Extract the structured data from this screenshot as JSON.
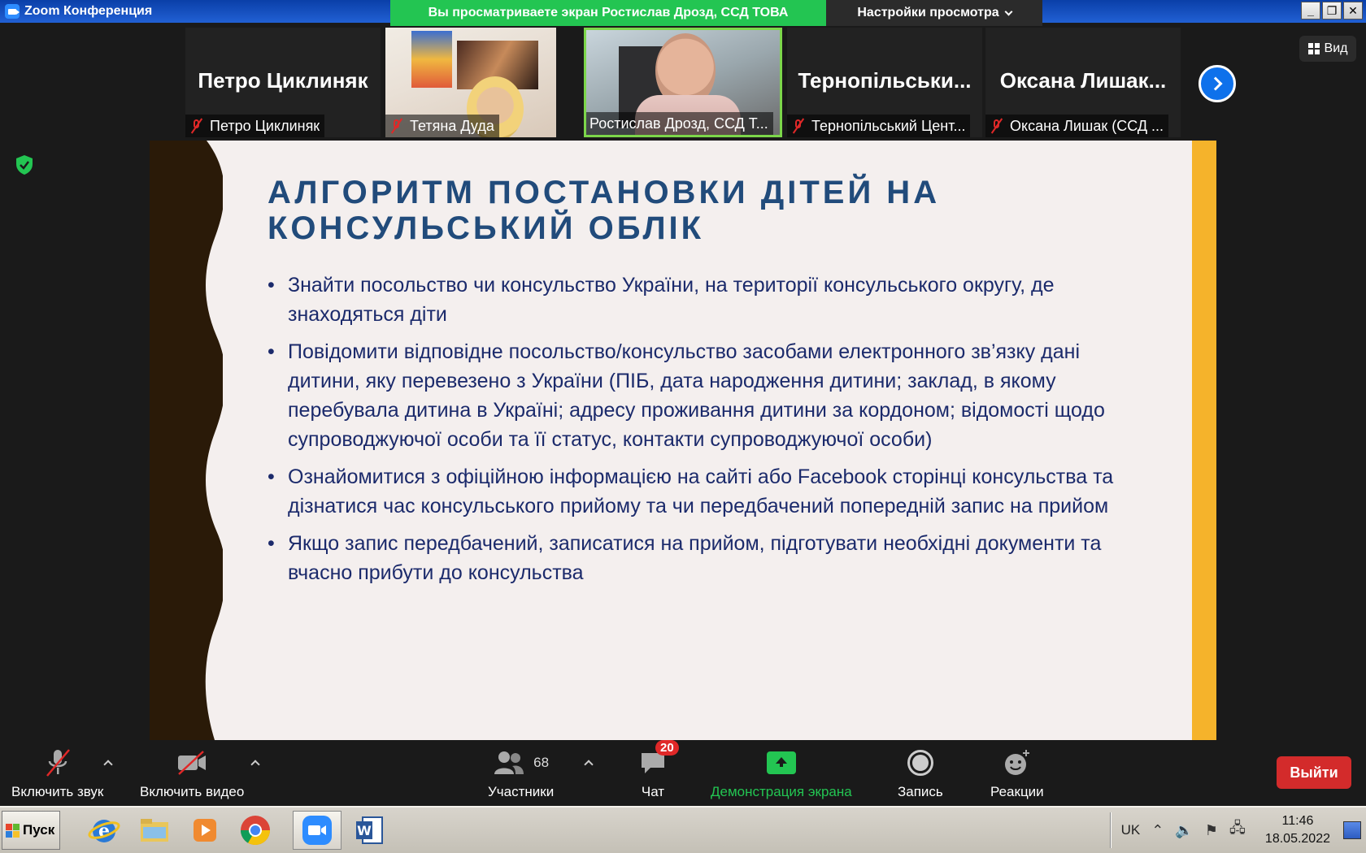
{
  "window": {
    "title": "Zoom Конференция"
  },
  "banner": {
    "sharing_text": "Вы просматриваете экран Ростислав Дрозд, ССД ТОВА",
    "view_settings": "Настройки просмотра"
  },
  "view_button": {
    "label": "Вид"
  },
  "participants_strip": [
    {
      "big_name": "Петро Циклиняк",
      "name": "Петро Циклиняк",
      "muted": true,
      "video": false
    },
    {
      "big_name": "",
      "name": "Тетяна Дуда",
      "muted": true,
      "video": true
    },
    {
      "big_name": "",
      "name": "Ростислав Дрозд, ССД Т...",
      "muted": false,
      "video": true,
      "active_speaker": true
    },
    {
      "big_name": "Тернопільськи...",
      "name": "Тернопільський Цент...",
      "muted": true,
      "video": false
    },
    {
      "big_name": "Оксана  Лишак...",
      "name": "Оксана  Лишак (ССД ...",
      "muted": true,
      "video": false
    }
  ],
  "slide": {
    "title_line1": "АЛГОРИТМ ПОСТАНОВКИ ДІТЕЙ НА",
    "title_line2": "КОНСУЛЬСЬКИЙ ОБЛІК",
    "bullets": [
      "Знайти посольство чи консульство України, на території консульського округу, де знаходяться діти",
      "Повідомити відповідне посольство/консульство засобами електронного зв’язку дані дитини, яку перевезено з України (ПІБ, дата народження дитини; заклад, в якому перебувала дитина в Україні; адресу проживання дитини за кордоном; відомості щодо супроводжуючої особи та її статус, контакти супроводжуючої особи)",
      "Ознайомитися з офіційною інформацією на сайті або Facebook сторінці консульства та дізнатися час консульського прийому та чи передбачений попередній запис на прийом",
      "Якщо запис передбачений, записатися на прийом, підготувати необхідні документи та вчасно прибути до консульства"
    ],
    "colors": {
      "title": "#214b7b",
      "text": "#1b2a6b",
      "accent": "#f5b32b",
      "wave": "#2a1a08"
    }
  },
  "toolbar": {
    "audio": "Включить звук",
    "video": "Включить видео",
    "participants": "Участники",
    "participants_count": "68",
    "chat": "Чат",
    "chat_badge": "20",
    "share": "Демонстрация экрана",
    "record": "Запись",
    "reactions": "Реакции",
    "leave": "Выйти"
  },
  "taskbar": {
    "start": "Пуск",
    "lang": "UK",
    "time": "11:46",
    "date": "18.05.2022"
  }
}
